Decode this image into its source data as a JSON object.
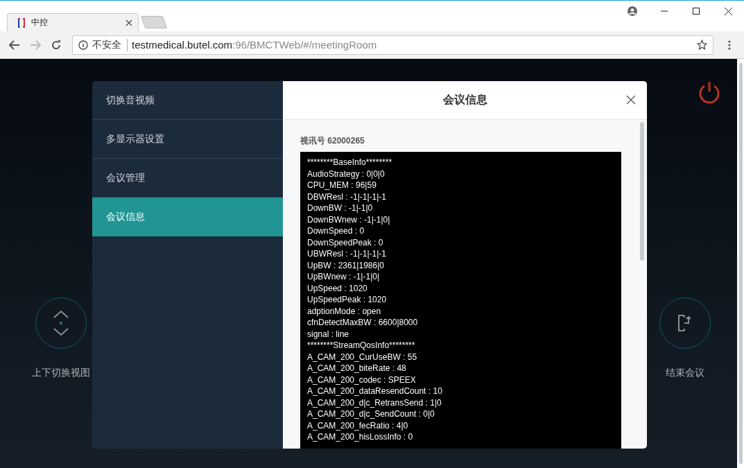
{
  "browser": {
    "tab_title": "中控",
    "security_label": "不安全",
    "url_host": "testmedical.butel.com",
    "url_path": ":96/BMCTWeb/#/meetingRoom"
  },
  "page": {
    "left_control": {
      "label": "上下切换视图"
    },
    "right_control": {
      "label": "结束会议"
    }
  },
  "dialog": {
    "title": "会议信息",
    "menu": [
      {
        "label": "切换音视频",
        "selected": false
      },
      {
        "label": "多显示器设置",
        "selected": false
      },
      {
        "label": "会议管理",
        "selected": false
      },
      {
        "label": "会议信息",
        "selected": true
      }
    ],
    "video_id_label": "视讯号 62000265",
    "info_lines": [
      "********BaseInfo********",
      "AudioStrategy : 0|0|0",
      "CPU_MEM : 96|59",
      "DBWResl : -1|-1|-1|-1",
      "DownBW : -1|-1|0",
      "DownBWnew : -1|-1|0|",
      "DownSpeed : 0",
      "DownSpeedPeak : 0",
      "UBWResl : -1|-1|-1|-1",
      "UpBW : 2361|1986|0",
      "UpBWnew : -1|-1|0|",
      "UpSpeed : 1020",
      "UpSpeedPeak : 1020",
      "adptionMode : open",
      "cfnDetectMaxBW : 6600|8000",
      "signal : line",
      "********StreamQosInfo********",
      "A_CAM_200_CurUseBW : 55",
      "A_CAM_200_biteRate : 48",
      "A_CAM_200_codec : SPEEX",
      "A_CAM_200_dataResendCount : 10",
      "A_CAM_200_d|c_RetransSend : 1|0",
      "A_CAM_200_d|c_SendCount : 0|0",
      "A_CAM_200_fecRatio : 4|0",
      "A_CAM_200_hisLossInfo : 0"
    ]
  }
}
